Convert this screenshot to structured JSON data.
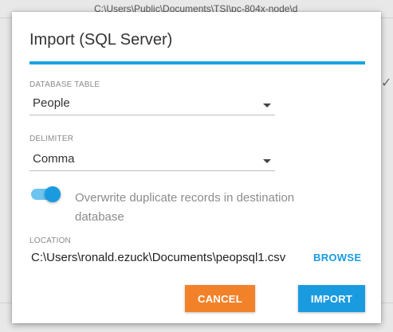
{
  "background": {
    "path_text": "C:\\Users\\Public\\Documents\\TSI\\pc-804x-node\\d"
  },
  "dialog": {
    "title": "Import (SQL Server)",
    "database_table": {
      "label": "DATABASE TABLE",
      "value": "People"
    },
    "delimiter": {
      "label": "DELIMITER",
      "value": "Comma"
    },
    "overwrite": {
      "label": "Overwrite duplicate records in destination database",
      "checked": true
    },
    "location": {
      "label": "LOCATION",
      "value": "C:\\Users\\ronald.ezuck\\Documents\\peopsql1.csv"
    },
    "browse_label": "BROWSE",
    "cancel_label": "CANCEL",
    "import_label": "IMPORT"
  },
  "colors": {
    "accent": "#1a9be0",
    "cancel": "#f2822a",
    "title_rule": "#1aa3e0"
  },
  "icons": {
    "select_caret": "chevron-down-icon",
    "background_check": "checkmark-icon"
  }
}
